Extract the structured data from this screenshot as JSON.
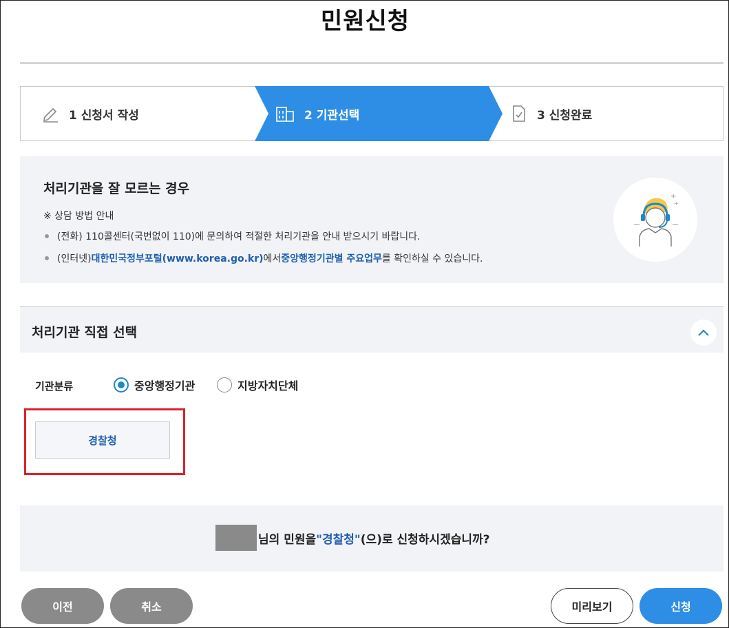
{
  "page": {
    "title": "민원신청"
  },
  "steps": [
    {
      "label": "1 신청서 작성",
      "icon": "pencil-icon"
    },
    {
      "label": "2 기관선택",
      "icon": "building-icon",
      "active": true,
      "color": "#2e8ee6"
    },
    {
      "label": "3 신청완료",
      "icon": "document-check-icon"
    }
  ],
  "info": {
    "title": "처리기관을 잘 모르는 경우",
    "note": "※ 상담 방법 안내",
    "phone": "(전화) 110콜센터(국번없이 110)에 문의하여 적절한 처리기관을 안내 받으시기 바랍니다.",
    "internet_prefix": "(인터넷) ",
    "internet_link1": "대한민국정부포털(www.korea.go.kr)",
    "internet_mid": "에서 ",
    "internet_link2": "중앙행정기관별 주요업무",
    "internet_suffix": "를 확인하실 수 있습니다.",
    "illustration": "call-center-advisor-icon"
  },
  "direct_select": {
    "title": "처리기관 직접 선택",
    "category_label": "기관분류",
    "options": [
      {
        "label": "중앙행정기관",
        "checked": true
      },
      {
        "label": "지방자치단체",
        "checked": false
      }
    ],
    "selected_agency": "경찰청"
  },
  "confirm": {
    "suffix1": "님의 민원을 ",
    "agency_quoted": "\"경찰청\"",
    "suffix2": "(으)로 신청하시겠습니까?"
  },
  "buttons": {
    "prev": "이전",
    "cancel": "취소",
    "preview": "미리보기",
    "submit": "신청"
  },
  "colors": {
    "accent": "#2e8ee6",
    "link": "#1f5fb0",
    "highlight": "#e0202a",
    "gray_button": "#8a8a8a"
  }
}
